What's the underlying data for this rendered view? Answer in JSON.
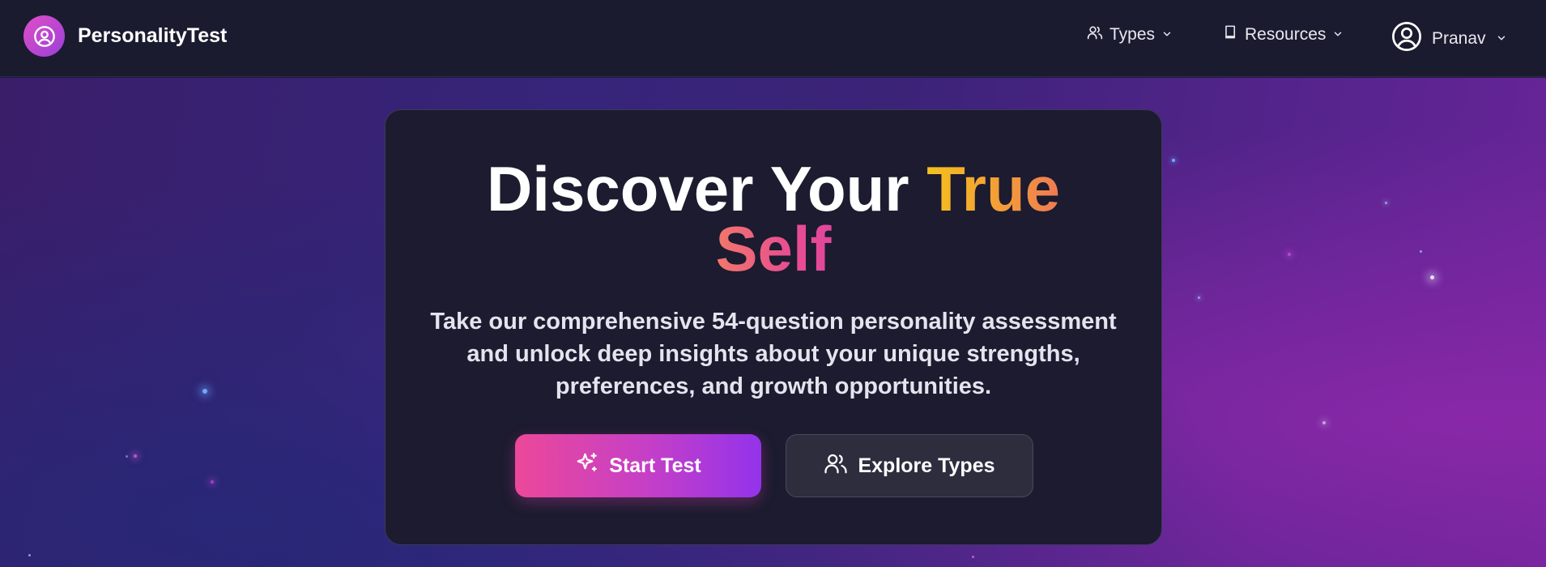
{
  "brand": {
    "name": "PersonalityTest",
    "logo_icon": "user-circle-icon"
  },
  "nav": {
    "types_label": "Types",
    "resources_label": "Resources",
    "user_label": "Pranav"
  },
  "hero": {
    "headline_part1": "Discover Your ",
    "headline_highlight1": "True",
    "headline_highlight2": "Self",
    "subtitle": "Take our comprehensive 54-question personality assessment and unlock deep insights about your unique strengths, preferences, and growth opportunities.",
    "start_button": "Start Test",
    "explore_button": "Explore Types"
  },
  "colors": {
    "accent_pink": "#ec4899",
    "accent_purple": "#9333ea",
    "highlight_yellow": "#f5c01e",
    "navbar_bg": "#1b1b2f",
    "card_bg": "#1c1b2f"
  }
}
